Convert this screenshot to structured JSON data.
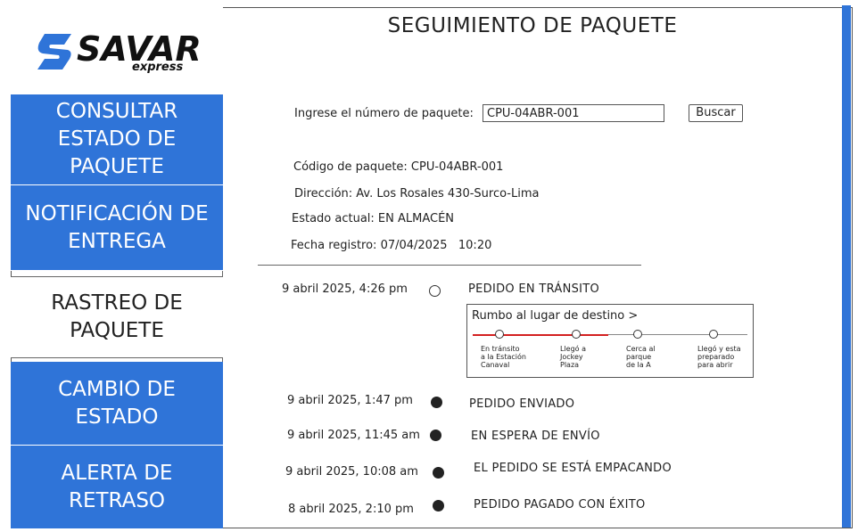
{
  "brand": {
    "name": "SAVAR",
    "tagline": "express"
  },
  "sidebar": {
    "items": [
      {
        "label": "CONSULTAR ESTADO DE PAQUETE"
      },
      {
        "label": "NOTIFICACIÓN DE ENTREGA"
      },
      {
        "label": "RASTREO DE PAQUETE"
      },
      {
        "label": "CAMBIO DE ESTADO"
      },
      {
        "label": "ALERTA DE RETRASO"
      }
    ]
  },
  "page": {
    "title": "SEGUIMIENTO DE PAQUETE"
  },
  "search": {
    "label": "Ingrese el número de paquete:",
    "value": "CPU-04ABR-001",
    "button": "Buscar"
  },
  "details": {
    "code": "Código de paquete: CPU-04ABR-001",
    "address": "Dirección: Av. Los Rosales 430-Surco-Lima",
    "status": "Estado actual: EN ALMACÉN",
    "date": "Fecha registro: 07/04/2025   10:20"
  },
  "timeline": [
    {
      "time": "9 abril 2025, 4:26 pm",
      "event": "PEDIDO EN TRÁNSITO",
      "current": true
    },
    {
      "time": "9 abril 2025, 1:47 pm",
      "event": "PEDIDO ENVIADO",
      "current": false
    },
    {
      "time": "9 abril 2025, 11:45 am",
      "event": "EN ESPERA DE ENVÍO",
      "current": false
    },
    {
      "time": "9 abril 2025, 10:08 am",
      "event": "EL PEDIDO SE ESTÁ EMPACANDO",
      "current": false
    },
    {
      "time": "8 abril 2025, 2:10 pm",
      "event": "PEDIDO PAGADO CON ÉXITO",
      "current": false
    }
  ],
  "route": {
    "title": "Rumbo al lugar de destino >",
    "progress": 0.5,
    "stops": [
      {
        "lines": [
          "En tránsito",
          "a la Estación",
          "Canaval"
        ]
      },
      {
        "lines": [
          "Llegó a",
          "Jockey",
          "Plaza"
        ]
      },
      {
        "lines": [
          "Cerca al",
          "parque",
          "de la A"
        ]
      },
      {
        "lines": [
          "Llegó y esta",
          "preparado",
          "para abrir"
        ]
      }
    ]
  },
  "colors": {
    "accent": "#2f74d8",
    "route_progress": "#d32020"
  }
}
